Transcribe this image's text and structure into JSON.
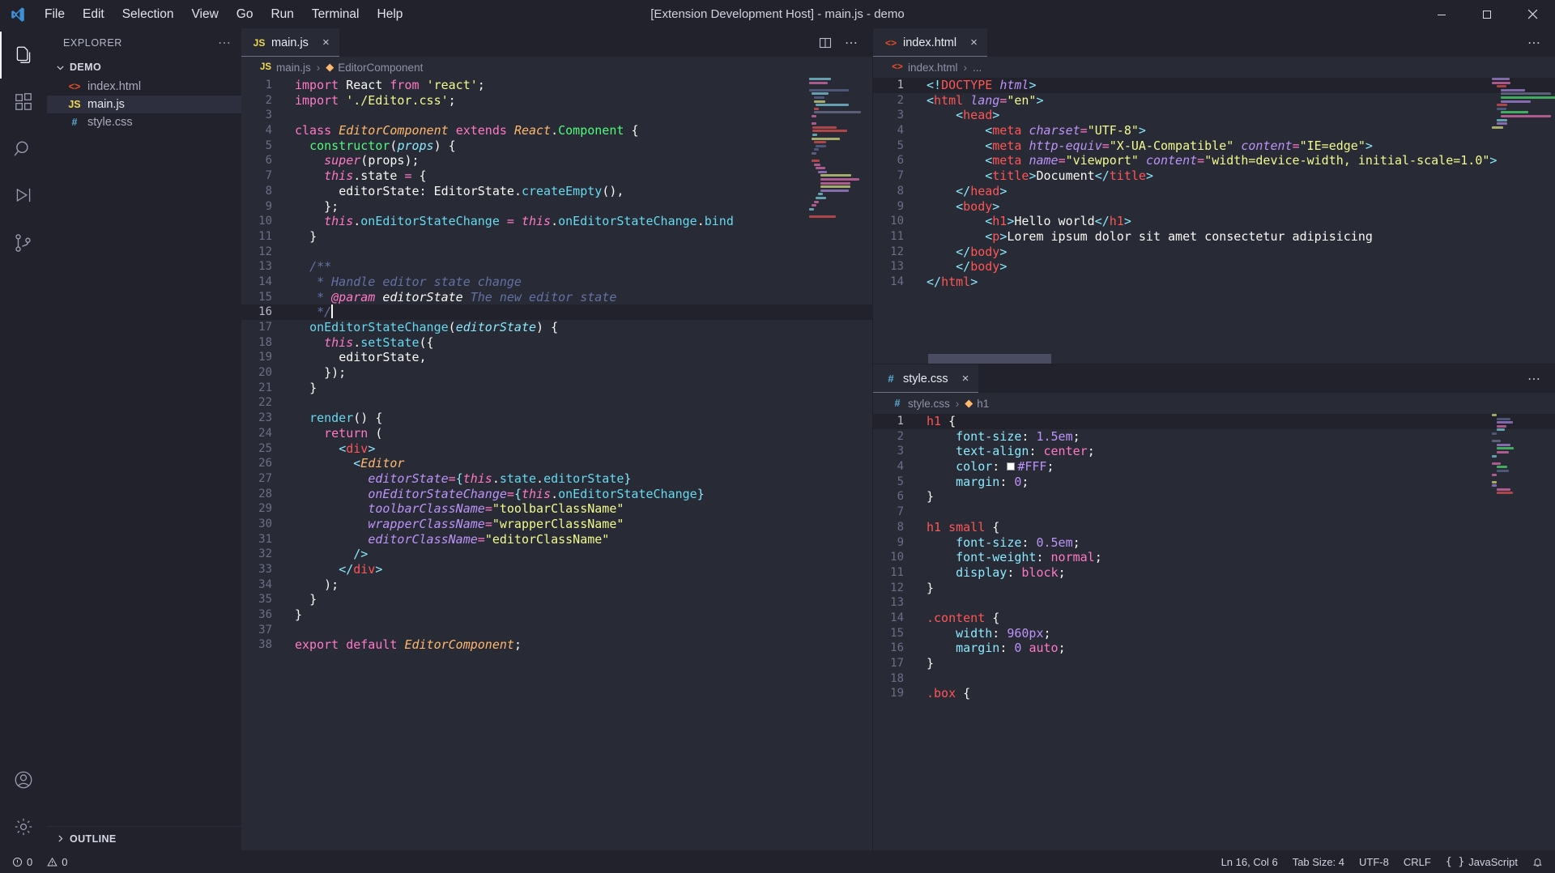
{
  "titlebar": {
    "window_title": "[Extension Development Host] - main.js - demo",
    "menus": [
      "File",
      "Edit",
      "Selection",
      "View",
      "Go",
      "Run",
      "Terminal",
      "Help"
    ],
    "controls": {
      "minimize": "minimize-icon",
      "maximize": "maximize-icon",
      "close": "close-icon"
    }
  },
  "activitybar": {
    "items": [
      {
        "name": "explorer",
        "icon": "files-icon",
        "active": true
      },
      {
        "name": "extensions",
        "icon": "extensions-icon",
        "active": false
      },
      {
        "name": "search",
        "icon": "search-icon",
        "active": false
      },
      {
        "name": "run-and-debug",
        "icon": "debug-icon",
        "active": false
      },
      {
        "name": "source-control",
        "icon": "source-control-icon",
        "active": false
      }
    ],
    "bottom": [
      {
        "name": "accounts",
        "icon": "account-icon"
      },
      {
        "name": "manage",
        "icon": "gear-icon"
      }
    ]
  },
  "sidebar": {
    "title": "EXPLORER",
    "more_actions": "⋯",
    "folder": {
      "label": "DEMO",
      "expanded": true,
      "chevron": "chevron-down-icon"
    },
    "files": [
      {
        "label": "index.html",
        "icon": "html-icon",
        "icon_glyph": "<>",
        "color": "#e44d26",
        "selected": false
      },
      {
        "label": "main.js",
        "icon": "js-icon",
        "icon_glyph": "JS",
        "color": "#f0db4f",
        "selected": true
      },
      {
        "label": "style.css",
        "icon": "css-icon",
        "icon_glyph": "#",
        "color": "#56b3d9",
        "selected": false
      }
    ],
    "outline": {
      "label": "OUTLINE",
      "chevron": "chevron-right-icon"
    }
  },
  "left_group": {
    "tab": {
      "label": "main.js",
      "icon_glyph": "JS",
      "close": "×"
    },
    "actions": {
      "split": "split-editor-icon",
      "more": "⋯"
    },
    "breadcrumb": {
      "file": "main.js",
      "sep": "›",
      "symbol": "EditorComponent",
      "icon_glyph": "JS"
    },
    "lines": [
      {
        "n": 1,
        "html": "<span class=\"k\">import</span> <span class=\"pl\">React</span> <span class=\"k\">from</span> <span class=\"str\">'react'</span><span class=\"pl\">;</span>"
      },
      {
        "n": 2,
        "html": "<span class=\"k\">import</span> <span class=\"str\">'./Editor.css'</span><span class=\"pl\">;</span>"
      },
      {
        "n": 3,
        "html": ""
      },
      {
        "n": 4,
        "html": "<span class=\"k\">class</span> <span class=\"vr\">EditorComponent</span> <span class=\"k\">extends</span> <span class=\"vr\">React</span><span class=\"pl\">.</span><span class=\"fn\">Component</span> <span class=\"pl\">{</span>"
      },
      {
        "n": 5,
        "html": "  <span class=\"fn\">constructor</span><span class=\"pl\">(</span><span class=\"ty\">props</span><span class=\"pl\">) {</span>"
      },
      {
        "n": 6,
        "html": "    <span class=\"kc\">super</span><span class=\"pl\">(</span><span class=\"pl\">props</span><span class=\"pl\">);</span>"
      },
      {
        "n": 7,
        "html": "    <span class=\"kc\">this</span><span class=\"pl\">.state </span><span class=\"op\">=</span><span class=\"pl\"> {</span>"
      },
      {
        "n": 8,
        "html": "      <span class=\"pl\">editorState: EditorState</span><span class=\"pl\">.</span><span class=\"prop\">createEmpty</span><span class=\"pl\">(),</span>"
      },
      {
        "n": 9,
        "html": "    <span class=\"pl\">};</span>"
      },
      {
        "n": 10,
        "html": "    <span class=\"kc\">this</span><span class=\"pl\">.</span><span class=\"prop\">onEditorStateChange</span> <span class=\"op\">=</span> <span class=\"kc\">this</span><span class=\"pl\">.</span><span class=\"prop\">onEditorStateChange</span><span class=\"pl\">.</span><span class=\"prop\">bind</span>"
      },
      {
        "n": 11,
        "html": "  <span class=\"pl\">}</span>"
      },
      {
        "n": 12,
        "html": ""
      },
      {
        "n": 13,
        "html": "  <span class=\"cm\">/**</span>"
      },
      {
        "n": 14,
        "html": "   <span class=\"cm\">* Handle editor state change</span>"
      },
      {
        "n": 15,
        "html": "   <span class=\"cm\">* </span><span class=\"cmb\">@param</span> <span class=\"cmi\">editorState</span> <span class=\"cm\">The new editor state</span>"
      },
      {
        "n": 16,
        "html": "   <span class=\"cm\">*/</span><span class=\"cursor\"></span>",
        "highlight": true
      },
      {
        "n": 17,
        "html": "  <span class=\"prop\">onEditorStateChange</span><span class=\"pl\">(</span><span class=\"ty\">editorState</span><span class=\"pl\">) {</span>"
      },
      {
        "n": 18,
        "html": "    <span class=\"kc\">this</span><span class=\"pl\">.</span><span class=\"prop\">setState</span><span class=\"pl\">({</span>"
      },
      {
        "n": 19,
        "html": "      <span class=\"pl\">editorState,</span>"
      },
      {
        "n": 20,
        "html": "    <span class=\"pl\">});</span>"
      },
      {
        "n": 21,
        "html": "  <span class=\"pl\">}</span>"
      },
      {
        "n": 22,
        "html": ""
      },
      {
        "n": 23,
        "html": "  <span class=\"prop\">render</span><span class=\"pl\">() {</span>"
      },
      {
        "n": 24,
        "html": "    <span class=\"k\">return</span> <span class=\"pl\">(</span>"
      },
      {
        "n": 25,
        "html": "      <span class=\"br\">&lt;</span><span class=\"tag\">div</span><span class=\"br\">&gt;</span>"
      },
      {
        "n": 26,
        "html": "        <span class=\"br\">&lt;</span><span class=\"vr\">Editor</span>"
      },
      {
        "n": 27,
        "html": "          <span class=\"atrn\">editorState</span><span class=\"op\">=</span><span class=\"br\">{</span><span class=\"kc\">this</span><span class=\"pl\">.</span><span class=\"prop\">state</span><span class=\"pl\">.</span><span class=\"prop\">editorState</span><span class=\"br\">}</span>"
      },
      {
        "n": 28,
        "html": "          <span class=\"atrn\">onEditorStateChange</span><span class=\"op\">=</span><span class=\"br\">{</span><span class=\"kc\">this</span><span class=\"pl\">.</span><span class=\"prop\">onEditorStateChange</span><span class=\"br\">}</span>"
      },
      {
        "n": 29,
        "html": "          <span class=\"atrn\">toolbarClassName</span><span class=\"op\">=</span><span class=\"str\">\"toolbarClassName\"</span>"
      },
      {
        "n": 30,
        "html": "          <span class=\"atrn\">wrapperClassName</span><span class=\"op\">=</span><span class=\"str\">\"wrapperClassName\"</span>"
      },
      {
        "n": 31,
        "html": "          <span class=\"atrn\">editorClassName</span><span class=\"op\">=</span><span class=\"str\">\"editorClassName\"</span>"
      },
      {
        "n": 32,
        "html": "        <span class=\"br\">/&gt;</span>"
      },
      {
        "n": 33,
        "html": "      <span class=\"br\">&lt;/</span><span class=\"tag\">div</span><span class=\"br\">&gt;</span>"
      },
      {
        "n": 34,
        "html": "    <span class=\"pl\">);</span>"
      },
      {
        "n": 35,
        "html": "  <span class=\"pl\">}</span>"
      },
      {
        "n": 36,
        "html": "<span class=\"pl\">}</span>"
      },
      {
        "n": 37,
        "html": ""
      },
      {
        "n": 38,
        "html": "<span class=\"k\">export</span> <span class=\"k\">default</span> <span class=\"vr\">EditorComponent</span><span class=\"pl\">;</span>"
      }
    ]
  },
  "right_top_group": {
    "tab": {
      "label": "index.html",
      "icon_glyph": "<>",
      "close": "×"
    },
    "actions": {
      "more": "⋯"
    },
    "breadcrumb": {
      "file": "index.html",
      "sep": "›",
      "symbol": "...",
      "icon_glyph": "<>"
    },
    "lines": [
      {
        "n": 1,
        "html": "<span class=\"br\">&lt;!</span><span class=\"tag\">DOCTYPE</span> <span class=\"atrn\">html</span><span class=\"br\">&gt;</span>",
        "highlight": true
      },
      {
        "n": 2,
        "html": "<span class=\"br\">&lt;</span><span class=\"tag\">html</span> <span class=\"atrn\">lang</span><span class=\"op\">=</span><span class=\"str\">\"en\"</span><span class=\"br\">&gt;</span>"
      },
      {
        "n": 3,
        "html": "    <span class=\"br\">&lt;</span><span class=\"tag\">head</span><span class=\"br\">&gt;</span>"
      },
      {
        "n": 4,
        "html": "        <span class=\"br\">&lt;</span><span class=\"tag\">meta</span> <span class=\"atrn\">charset</span><span class=\"op\">=</span><span class=\"str\">\"UTF-8\"</span><span class=\"br\">&gt;</span>"
      },
      {
        "n": 5,
        "html": "        <span class=\"br\">&lt;</span><span class=\"tag\">meta</span> <span class=\"atrn\">http-equiv</span><span class=\"op\">=</span><span class=\"str\">\"X-UA-Compatible\"</span> <span class=\"atrn\">content</span><span class=\"op\">=</span><span class=\"str\">\"IE=edge\"</span><span class=\"br\">&gt;</span>"
      },
      {
        "n": 6,
        "html": "        <span class=\"br\">&lt;</span><span class=\"tag\">meta</span> <span class=\"atrn\">name</span><span class=\"op\">=</span><span class=\"str\">\"viewport\"</span> <span class=\"atrn\">content</span><span class=\"op\">=</span><span class=\"str\">\"width=device-width, initial-scale=1.0\"</span><span class=\"br\">&gt;</span>"
      },
      {
        "n": 7,
        "html": "        <span class=\"br\">&lt;</span><span class=\"tag\">title</span><span class=\"br\">&gt;</span><span class=\"pl\">Document</span><span class=\"br\">&lt;/</span><span class=\"tag\">title</span><span class=\"br\">&gt;</span>"
      },
      {
        "n": 8,
        "html": "    <span class=\"br\">&lt;/</span><span class=\"tag\">head</span><span class=\"br\">&gt;</span>"
      },
      {
        "n": 9,
        "html": "    <span class=\"br\">&lt;</span><span class=\"tag\">body</span><span class=\"br\">&gt;</span>"
      },
      {
        "n": 10,
        "html": "        <span class=\"br\">&lt;</span><span class=\"tag\">h1</span><span class=\"br\">&gt;</span><span class=\"pl\">Hello world</span><span class=\"br\">&lt;/</span><span class=\"tag\">h1</span><span class=\"br\">&gt;</span>"
      },
      {
        "n": 11,
        "html": "        <span class=\"br\">&lt;</span><span class=\"tag\">p</span><span class=\"br\">&gt;</span><span class=\"pl\">Lorem ipsum dolor sit amet consectetur adipisicing</span>"
      },
      {
        "n": 12,
        "html": "    <span class=\"br\">&lt;/</span><span class=\"tag\">body</span><span class=\"br\">&gt;</span>"
      },
      {
        "n": 13,
        "html": "    <span class=\"br\">&lt;/</span><span class=\"tag\">body</span><span class=\"br\">&gt;</span>"
      },
      {
        "n": 14,
        "html": "<span class=\"br\">&lt;/</span><span class=\"tag\">html</span><span class=\"br\">&gt;</span>"
      }
    ]
  },
  "right_bottom_group": {
    "tab": {
      "label": "style.css",
      "icon_glyph": "#",
      "close": "×"
    },
    "actions": {
      "more": "⋯"
    },
    "breadcrumb": {
      "file": "style.css",
      "sep": "›",
      "symbol": "h1",
      "icon_glyph": "#"
    },
    "lines": [
      {
        "n": 1,
        "html": "<span class=\"cssSel\">h1</span> <span class=\"pl\">{</span>",
        "highlight": true
      },
      {
        "n": 2,
        "html": "    <span class=\"cssProp\">font-size</span><span class=\"pl\">: </span><span class=\"cssVal\">1.5em</span><span class=\"pl\">;</span>"
      },
      {
        "n": 3,
        "html": "    <span class=\"cssProp\">text-align</span><span class=\"pl\">: </span><span class=\"cssKw\">center</span><span class=\"pl\">;</span>"
      },
      {
        "n": 4,
        "html": "    <span class=\"cssProp\">color</span><span class=\"pl\">: </span><span class=\"swatch\"></span><span class=\"cssVal\">#FFF</span><span class=\"pl\">;</span>"
      },
      {
        "n": 5,
        "html": "    <span class=\"cssProp\">margin</span><span class=\"pl\">: </span><span class=\"cssVal\">0</span><span class=\"pl\">;</span>"
      },
      {
        "n": 6,
        "html": "<span class=\"pl\">}</span>"
      },
      {
        "n": 7,
        "html": ""
      },
      {
        "n": 8,
        "html": "<span class=\"cssSel\">h1 small</span> <span class=\"pl\">{</span>"
      },
      {
        "n": 9,
        "html": "    <span class=\"cssProp\">font-size</span><span class=\"pl\">: </span><span class=\"cssVal\">0.5em</span><span class=\"pl\">;</span>"
      },
      {
        "n": 10,
        "html": "    <span class=\"cssProp\">font-weight</span><span class=\"pl\">: </span><span class=\"cssKw\">normal</span><span class=\"pl\">;</span>"
      },
      {
        "n": 11,
        "html": "    <span class=\"cssProp\">display</span><span class=\"pl\">: </span><span class=\"cssKw\">block</span><span class=\"pl\">;</span>"
      },
      {
        "n": 12,
        "html": "<span class=\"pl\">}</span>"
      },
      {
        "n": 13,
        "html": ""
      },
      {
        "n": 14,
        "html": "<span class=\"cssSel\">.content</span> <span class=\"pl\">{</span>"
      },
      {
        "n": 15,
        "html": "    <span class=\"cssProp\">width</span><span class=\"pl\">: </span><span class=\"cssVal\">960px</span><span class=\"pl\">;</span>"
      },
      {
        "n": 16,
        "html": "    <span class=\"cssProp\">margin</span><span class=\"pl\">: </span><span class=\"cssVal\">0</span> <span class=\"cssKw\">auto</span><span class=\"pl\">;</span>"
      },
      {
        "n": 17,
        "html": "<span class=\"pl\">}</span>"
      },
      {
        "n": 18,
        "html": ""
      },
      {
        "n": 19,
        "html": "<span class=\"cssSel\">.box</span> <span class=\"pl\">{</span>"
      }
    ]
  },
  "statusbar": {
    "left": [
      {
        "name": "remote-problems-errors",
        "icon": "error-icon",
        "text": "0"
      },
      {
        "name": "problems-warnings",
        "icon": "warning-icon",
        "text": "0"
      }
    ],
    "right": [
      {
        "name": "editor-position",
        "text": "Ln 16, Col 6"
      },
      {
        "name": "tab-size",
        "text": "Tab Size: 4"
      },
      {
        "name": "encoding",
        "text": "UTF-8"
      },
      {
        "name": "eol",
        "text": "CRLF"
      },
      {
        "name": "language-mode",
        "text": "JavaScript",
        "icon": "braces-icon"
      },
      {
        "name": "notifications",
        "icon": "bell-icon",
        "text": ""
      }
    ]
  },
  "theme": {
    "background": "#282a36",
    "chrome": "#21222c",
    "accent": "#bd93f9",
    "status_text": "#cfd1de"
  }
}
